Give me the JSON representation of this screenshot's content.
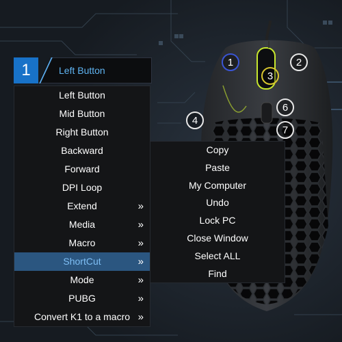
{
  "header": {
    "number": "1",
    "title": "Left Button"
  },
  "menu": {
    "items": [
      {
        "label": "Left Button",
        "arrow": "",
        "active": false
      },
      {
        "label": "Mid Button",
        "arrow": "",
        "active": false
      },
      {
        "label": "Right Button",
        "arrow": "",
        "active": false
      },
      {
        "label": "Backward",
        "arrow": "",
        "active": false
      },
      {
        "label": "Forward",
        "arrow": "",
        "active": false
      },
      {
        "label": "DPI Loop",
        "arrow": "",
        "active": false
      },
      {
        "label": "Extend",
        "arrow": "»",
        "active": false
      },
      {
        "label": "Media",
        "arrow": "»",
        "active": false
      },
      {
        "label": "Macro",
        "arrow": "»",
        "active": false
      },
      {
        "label": "ShortCut",
        "arrow": "»",
        "active": true
      },
      {
        "label": "Mode",
        "arrow": "»",
        "active": false
      },
      {
        "label": "PUBG",
        "arrow": "»",
        "active": false
      },
      {
        "label": "Convert K1 to a macro",
        "arrow": "»",
        "active": false
      }
    ]
  },
  "submenu": {
    "items": [
      "Copy",
      "Paste",
      "My Computer",
      "Undo",
      "Lock PC",
      "Close Window",
      "Select ALL",
      "Find"
    ]
  },
  "mouse": {
    "buttons": [
      "1",
      "2",
      "3",
      "4",
      "6",
      "7"
    ]
  },
  "colors": {
    "accent": "#1872c8",
    "active_row": "#2b5680",
    "header_text": "#5fb4f2",
    "menu_bg": "#141517",
    "background": "#1d242c"
  }
}
